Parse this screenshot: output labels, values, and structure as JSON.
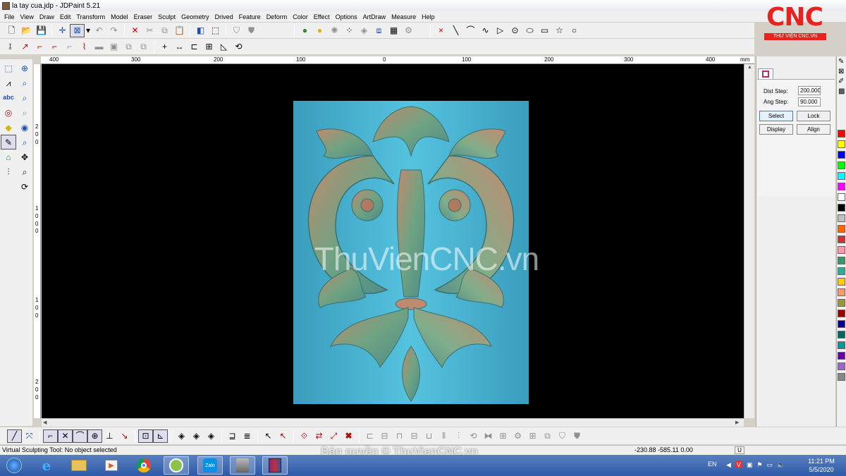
{
  "window": {
    "title": "la tay cua.jdp - JDPaint 5.21"
  },
  "menu": [
    "File",
    "View",
    "Draw",
    "Edit",
    "Transform",
    "Model",
    "Eraser",
    "Sculpt",
    "Geometry",
    "Drived",
    "Feature",
    "Deform",
    "Color",
    "Effect",
    "Options",
    "ArtDraw",
    "Measure",
    "Help"
  ],
  "logo": {
    "text": "CNC",
    "subtitle": "THƯ VIỆN CNC.VN",
    "color": "#e8231e"
  },
  "ruler": {
    "horizontal_labels": [
      "400",
      "300",
      "200",
      "100",
      "0",
      "100",
      "200",
      "300",
      "400",
      "mm"
    ],
    "vertical_labels": [
      "2",
      "0",
      "0",
      "1",
      "0",
      "0",
      "0",
      "1",
      "0",
      "0",
      "2",
      "0",
      "0"
    ]
  },
  "panel": {
    "dist_step_label": "Dist Step:",
    "dist_step_value": "200.000",
    "ang_step_label": "Ang Step:",
    "ang_step_value": "90.000",
    "buttons": {
      "select": "Select",
      "lock": "Lock",
      "display": "Display",
      "align": "Align"
    }
  },
  "palette": [
    "#ff0000",
    "#ffff00",
    "#0000ff",
    "#00ff00",
    "#00ffff",
    "#ff00ff",
    "#ffffff",
    "#000000",
    "#c0c0c0",
    "#ff6600",
    "#cc3333",
    "#ff99aa",
    "#339966",
    "#33aa99",
    "#ffcc00",
    "#ff9966",
    "#999933",
    "#990000",
    "#000099",
    "#006666",
    "#009999",
    "#660099",
    "#9966cc",
    "#888888"
  ],
  "canvas": {
    "background": "#000000",
    "relief_background": "#49b6d2",
    "watermark": "ThuVienCNC.vn"
  },
  "status": {
    "message": "Virtual Sculpting Tool: No object selected",
    "coordinates": "-230.88 -585.11 0.00",
    "indicator": "U"
  },
  "copyright": "Bản quyền © ThuVienCNC.vn",
  "taskbar": {
    "language": "EN",
    "time": "11:21 PM",
    "date": "5/5/2020"
  }
}
